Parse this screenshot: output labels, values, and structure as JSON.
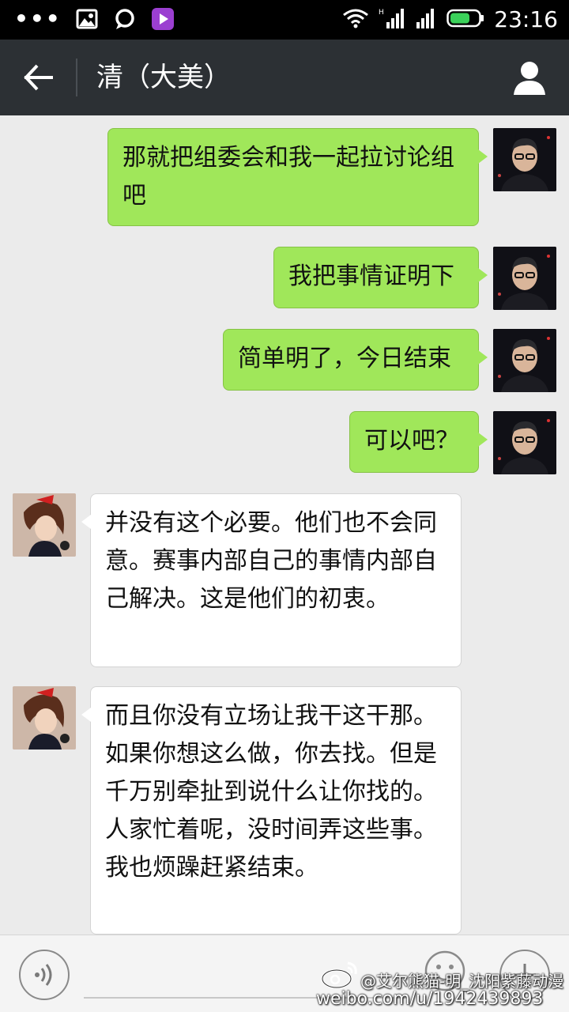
{
  "status_bar": {
    "time": "23:16",
    "icons": [
      "more-dots-icon",
      "image-icon",
      "chat-bubble-icon",
      "video-player-icon",
      "wifi-icon",
      "signal-icon",
      "signal-icon",
      "battery-icon"
    ],
    "dots": "•••"
  },
  "header": {
    "title": "清（大美）",
    "back_icon": "back-arrow-icon",
    "profile_icon": "person-icon"
  },
  "messages": [
    {
      "from": "me",
      "text": "那就把组委会和我一起拉讨论组吧"
    },
    {
      "from": "me",
      "text": "我把事情证明下"
    },
    {
      "from": "me",
      "text": "简单明了，今日结束"
    },
    {
      "from": "me",
      "text": "可以吧？"
    },
    {
      "from": "contact",
      "text": "并没有这个必要。他们也不会同意。赛事内部自己的事情内部自己解决。这是他们的初衷。"
    },
    {
      "from": "contact",
      "text": "而且你没有立场让我干这干那。如果你想这么做，你去找。但是千万别牵扯到说什么让你找的。人家忙着呢，没时间弄这些事。我也烦躁赶紧结束。"
    }
  ],
  "input_bar": {
    "voice_icon": "voice-icon",
    "emoji_icon": "smiley-icon",
    "plus_icon": "plus-icon",
    "text_value": ""
  },
  "watermark": {
    "line1": "@艾尔熊猫-明_沈阳紫藤动漫",
    "line2": "weibo.com/u/1942439893",
    "logo_icon": "weibo-logo-icon"
  },
  "colors": {
    "status_bar": "#000000",
    "title_bar": "#2c3034",
    "background": "#ebebeb",
    "outgoing_bubble": "#a0e75a",
    "incoming_bubble": "#ffffff"
  }
}
